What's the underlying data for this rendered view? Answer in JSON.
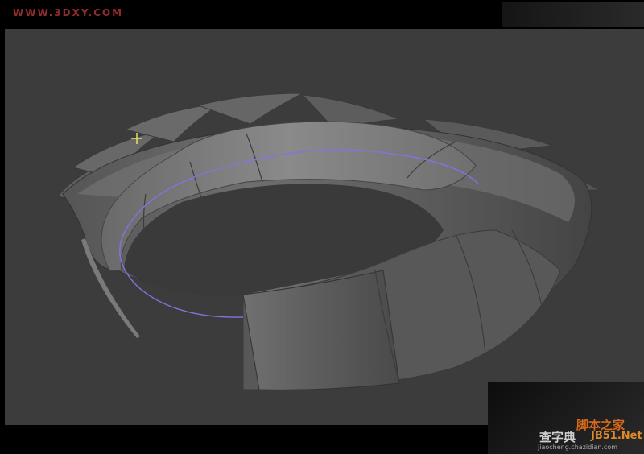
{
  "header": {
    "site_logo": "WWW.3DXY.COM"
  },
  "watermark": {
    "line_top": "脚本之家",
    "line_mid": "JB51.Net",
    "site_name": "查字典",
    "url": "jiaocheng.chazidian.com"
  },
  "colors": {
    "viewport_bg": "#3c3c3c",
    "spline": "#8a6fe0",
    "cursor": "#e8e060",
    "logo": "#8f2c2c"
  },
  "icons": {
    "cursor": "crosshair-cursor-icon"
  }
}
